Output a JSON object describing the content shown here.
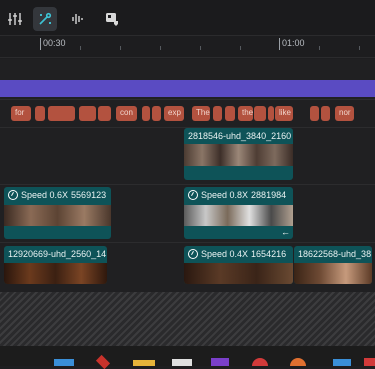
{
  "ruler": {
    "marks": [
      "00:30",
      "01:00"
    ]
  },
  "captions": {
    "words": [
      "for",
      "",
      "",
      "",
      "",
      "con",
      "",
      "",
      "exp",
      "The",
      "",
      "",
      "the",
      "",
      "",
      "like",
      "",
      "",
      "nor"
    ]
  },
  "clips": {
    "top": {
      "label": "2818546-uhd_3840_2160"
    },
    "mid_left": {
      "speed": "Speed 0.6X",
      "name": "5569123"
    },
    "mid_right": {
      "speed": "Speed 0.8X",
      "name": "2881984"
    },
    "bottom_left": {
      "name": "12920669-uhd_2560_14"
    },
    "bottom_mid": {
      "speed": "Speed 0.4X",
      "name": "1654216"
    },
    "bottom_right": {
      "name": "18622568-uhd_38"
    }
  },
  "colors": {
    "accent_teal": "#0e5358",
    "accent_purple": "#5a4bc2",
    "caption_red": "#b3523f"
  },
  "icons": [
    "adjust-sliders-icon",
    "magic-pen-icon",
    "audio-waveform-icon",
    "media-import-icon"
  ]
}
